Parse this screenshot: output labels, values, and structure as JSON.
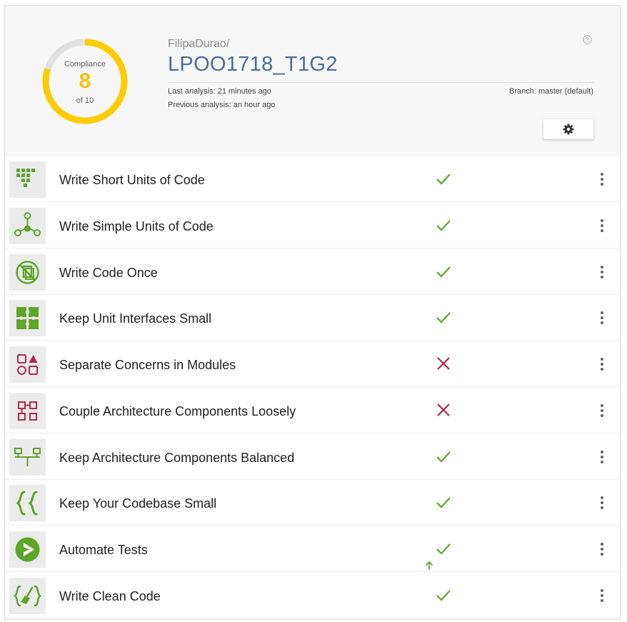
{
  "compliance": {
    "label": "Compliance",
    "score": "8",
    "of_text": "of 10",
    "score_fraction": 0.8,
    "accent_color": "#ffcc00"
  },
  "repository": {
    "owner": "FilipaDurao/",
    "name": "LPOO1718_T1G2",
    "last_analysis": "Last analysis: 21 minutes ago",
    "previous_analysis": "Previous analysis: an hour ago",
    "branch": "Branch: master (default)"
  },
  "header_icons": {
    "help": "help-circle-icon",
    "settings": "gear-icon"
  },
  "colors": {
    "pass": "#5ea52a",
    "fail": "#b0284a",
    "title": "#4a6c9b"
  },
  "guidelines": [
    {
      "label": "Write Short Units of Code",
      "status": "pass",
      "icon": "short-units-icon"
    },
    {
      "label": "Write Simple Units of Code",
      "status": "pass",
      "icon": "simple-units-icon"
    },
    {
      "label": "Write Code Once",
      "status": "pass",
      "icon": "code-once-icon"
    },
    {
      "label": "Keep Unit Interfaces Small",
      "status": "pass",
      "icon": "puzzle-icon"
    },
    {
      "label": "Separate Concerns in Modules",
      "status": "fail",
      "icon": "modules-icon"
    },
    {
      "label": "Couple Architecture Components Loosely",
      "status": "fail",
      "icon": "components-icon"
    },
    {
      "label": "Keep Architecture Components Balanced",
      "status": "pass",
      "icon": "balance-icon"
    },
    {
      "label": "Keep Your Codebase Small",
      "status": "pass",
      "icon": "braces-icon"
    },
    {
      "label": "Automate Tests",
      "status": "pass",
      "icon": "play-icon",
      "trend": "up"
    },
    {
      "label": "Write Clean Code",
      "status": "pass",
      "icon": "broom-icon"
    }
  ]
}
